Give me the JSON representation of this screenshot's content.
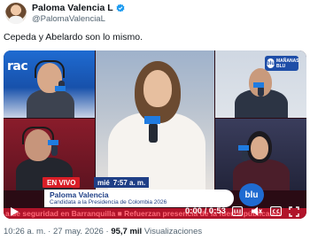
{
  "author": {
    "name": "Paloma Valencia L",
    "handle": "@PalomaValenciaL",
    "verified": true
  },
  "tweet": {
    "text": "Cepeda y Abelardo son lo mismo."
  },
  "video": {
    "top_left_logo": "rac",
    "radio_badge": "MAÑANAS BLU",
    "radio_badge_mark": "blu",
    "live_label": "EN VIVO",
    "day_label": "mié",
    "clock": "7:57 a. m.",
    "guest_name": "Paloma Valencia",
    "guest_role": "Candidata a la Presidencia de Colombia 2026",
    "channel_logo": "blu",
    "ticker": "a de seguridad en Barranquilla  ■  Refuerzan presencia de la fuerza pública en",
    "time_current": "0:00",
    "time_total": "0:53",
    "time_display": "0:00 / 0:53",
    "controls": [
      "play-icon",
      "gif-icon",
      "volume-icon",
      "captions-icon",
      "fullscreen-icon"
    ]
  },
  "meta": {
    "time": "10:26 a. m.",
    "date": "27 may. 2026",
    "separator": "·",
    "views_count": "95,7 mil",
    "views_label": "Visualizaciones"
  },
  "colors": {
    "verified": "#1d9bf0",
    "live_red": "#d91e27",
    "brand_blue": "#1f3f86",
    "ticker_red": "#b0142a",
    "secondary_text": "#536471"
  }
}
